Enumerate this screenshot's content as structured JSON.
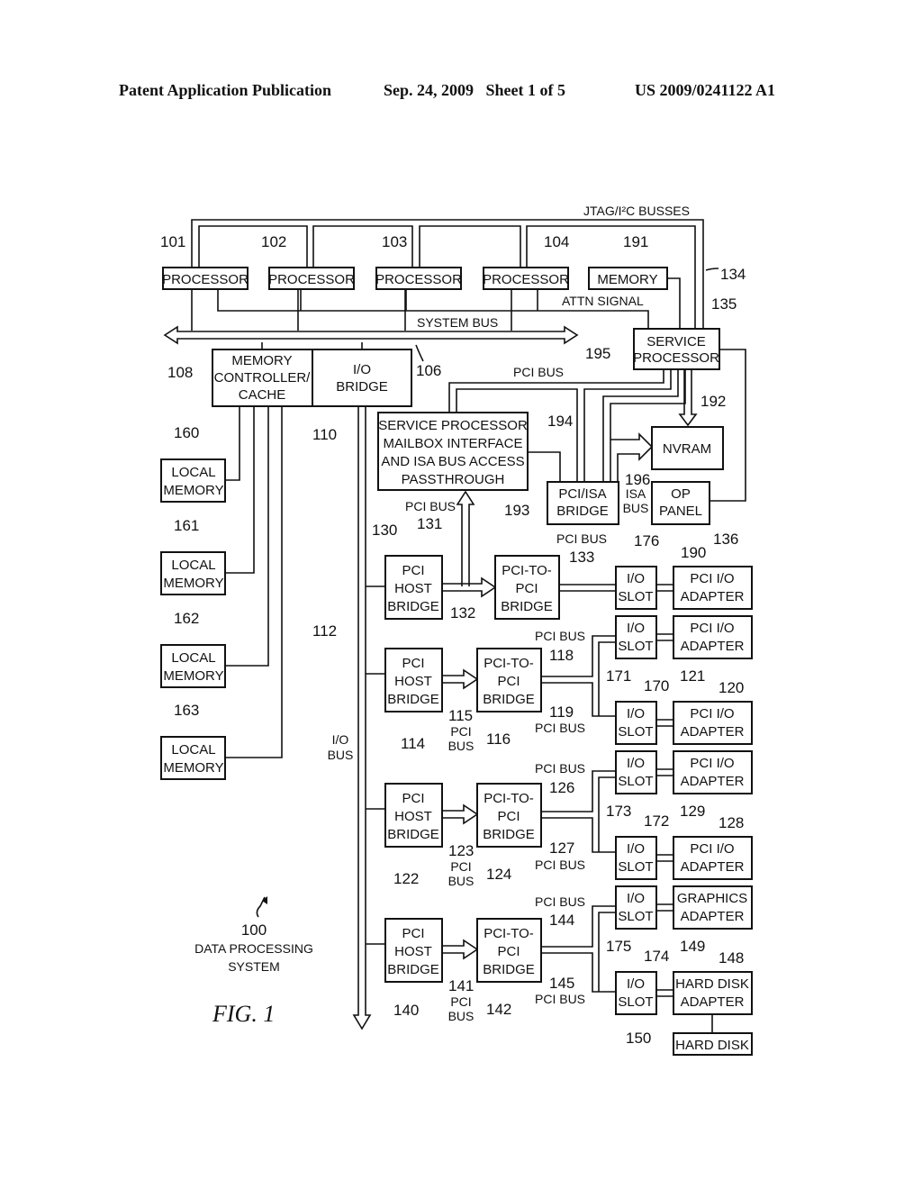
{
  "header": {
    "left": "Patent Application Publication",
    "middle": "Sep. 24, 2009   Sheet 1 of 5",
    "right": "US 2009/0241122 A1"
  },
  "figure": {
    "caption": "FIG. 1",
    "system_ref": "100",
    "system_label_1": "DATA PROCESSING",
    "system_label_2": "SYSTEM"
  },
  "buses": {
    "jtag": "JTAG/I²C BUSSES",
    "jtag_ref": "134",
    "system_bus": "SYSTEM BUS",
    "system_bus_ref": "106",
    "attn": "ATTN SIGNAL",
    "pci_bus": "PCI BUS",
    "pci_bus_195_ref": "195",
    "isa_ref": "196",
    "isa_1": "ISA",
    "isa_2": "BUS",
    "io_bus_1": "I/O",
    "io_bus_2": "BUS",
    "io_bus_ref": "112",
    "pci_bus_131_ref": "131",
    "pci_bus_133_ref": "133",
    "pci_bus_115_ref": "115",
    "pci_bus_118_ref": "118",
    "pci_bus_119_ref": "119",
    "pci_bus_123_ref": "123",
    "pci_bus_126_ref": "126",
    "pci_bus_127_ref": "127",
    "pci_bus_141_ref": "141",
    "pci_bus_144_ref": "144",
    "pci_bus_145_ref": "145",
    "pci": "PCI",
    "bus": "BUS"
  },
  "blocks": {
    "processors": [
      {
        "ref": "101",
        "label": "PROCESSOR"
      },
      {
        "ref": "102",
        "label": "PROCESSOR"
      },
      {
        "ref": "103",
        "label": "PROCESSOR"
      },
      {
        "ref": "104",
        "label": "PROCESSOR"
      }
    ],
    "memory": {
      "ref": "191",
      "label": "MEMORY"
    },
    "service_processor": {
      "ref": "135",
      "line1": "SERVICE",
      "line2": "PROCESSOR"
    },
    "mem_controller": {
      "ref": "108",
      "line1": "MEMORY",
      "line2": "CONTROLLER/",
      "line3": "CACHE"
    },
    "io_bridge": {
      "ref": "110",
      "line1": "I/O",
      "line2": "BRIDGE"
    },
    "local_memories": [
      {
        "ref": "160",
        "line1": "LOCAL",
        "line2": "MEMORY"
      },
      {
        "ref": "161",
        "line1": "LOCAL",
        "line2": "MEMORY"
      },
      {
        "ref": "162",
        "line1": "LOCAL",
        "line2": "MEMORY"
      },
      {
        "ref": "163",
        "line1": "LOCAL",
        "line2": "MEMORY"
      }
    ],
    "mailbox": {
      "ref": "194",
      "line1": "SERVICE PROCESSOR",
      "line2": "MAILBOX INTERFACE",
      "line3": "AND ISA BUS ACCESS",
      "line4": "PASSTHROUGH"
    },
    "nvram": {
      "ref": "192",
      "label": "NVRAM"
    },
    "pci_isa": {
      "ref": "193",
      "line1": "PCI/ISA",
      "line2": "BRIDGE"
    },
    "op_panel": {
      "ref": "190",
      "line1": "OP",
      "line2": "PANEL"
    },
    "host_bridges": [
      {
        "ref": "130",
        "line1": "PCI",
        "line2": "HOST",
        "line3": "BRIDGE"
      },
      {
        "ref": "114",
        "line1": "PCI",
        "line2": "HOST",
        "line3": "BRIDGE"
      },
      {
        "ref": "122",
        "line1": "PCI",
        "line2": "HOST",
        "line3": "BRIDGE"
      },
      {
        "ref": "140",
        "line1": "PCI",
        "line2": "HOST",
        "line3": "BRIDGE"
      }
    ],
    "p2p_bridges": [
      {
        "ref": "132",
        "line1": "PCI-TO-",
        "line2": "PCI",
        "line3": "BRIDGE"
      },
      {
        "ref": "116",
        "line1": "PCI-TO-",
        "line2": "PCI",
        "line3": "BRIDGE"
      },
      {
        "ref": "124",
        "line1": "PCI-TO-",
        "line2": "PCI",
        "line3": "BRIDGE"
      },
      {
        "ref": "142",
        "line1": "PCI-TO-",
        "line2": "PCI",
        "line3": "BRIDGE"
      }
    ],
    "slots": [
      {
        "ref": "176",
        "line1": "I/O",
        "line2": "SLOT"
      },
      {
        "ref": "170",
        "line1": "I/O",
        "line2": "SLOT"
      },
      {
        "ref": "171",
        "line1": "I/O",
        "line2": "SLOT"
      },
      {
        "ref": "172",
        "line1": "I/O",
        "line2": "SLOT"
      },
      {
        "ref": "173",
        "line1": "I/O",
        "line2": "SLOT"
      },
      {
        "ref": "174",
        "line1": "I/O",
        "line2": "SLOT"
      },
      {
        "ref": "175",
        "line1": "I/O",
        "line2": "SLOT"
      }
    ],
    "adapters": [
      {
        "ref": "136",
        "line1": "PCI I/O",
        "line2": "ADAPTER"
      },
      {
        "ref": "120",
        "line1": "PCI I/O",
        "line2": "ADAPTER"
      },
      {
        "ref": "121",
        "line1": "PCI I/O",
        "line2": "ADAPTER"
      },
      {
        "ref": "128",
        "line1": "PCI I/O",
        "line2": "ADAPTER"
      },
      {
        "ref": "129",
        "line1": "PCI I/O",
        "line2": "ADAPTER"
      },
      {
        "ref": "148",
        "line1": "GRAPHICS",
        "line2": "ADAPTER"
      },
      {
        "ref": "149",
        "line1": "HARD DISK",
        "line2": "ADAPTER"
      }
    ],
    "hard_disk": {
      "ref": "150",
      "label": "HARD DISK"
    }
  }
}
